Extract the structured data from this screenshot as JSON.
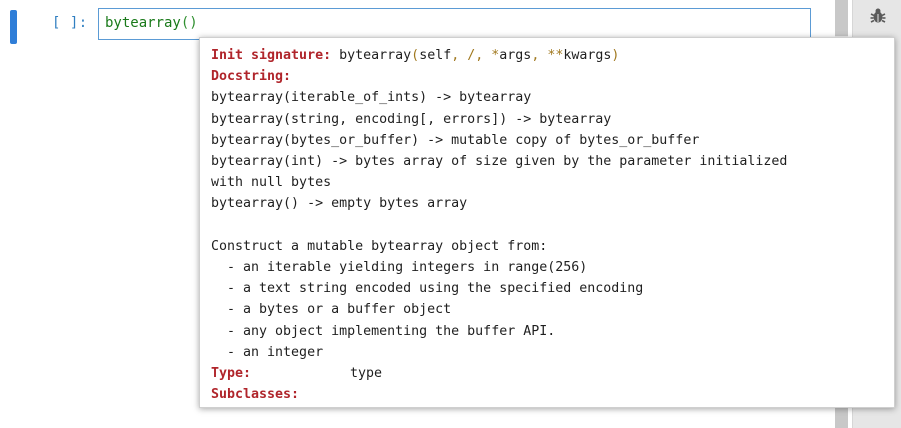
{
  "cell": {
    "prompt": "[ ]:",
    "code_name": "bytearray",
    "code_parens": "()"
  },
  "tooltip": {
    "init_signature_label": "Init signature:",
    "signature_parts": [
      "bytearray",
      "(",
      "self",
      ", ",
      "/",
      ", ",
      "*",
      "args",
      ", ",
      "**",
      "kwargs",
      ")"
    ],
    "docstring_label": "Docstring:",
    "docstring_lines": [
      "bytearray(iterable_of_ints) -> bytearray",
      "bytearray(string, encoding[, errors]) -> bytearray",
      "bytearray(bytes_or_buffer) -> mutable copy of bytes_or_buffer",
      "bytearray(int) -> bytes array of size given by the parameter initialized",
      "with null bytes",
      "bytearray() -> empty bytes array",
      "",
      "Construct a mutable bytearray object from:",
      "  - an iterable yielding integers in range(256)",
      "  - a text string encoded using the specified encoding",
      "  - a bytes or a buffer object",
      "  - any object implementing the buffer API.",
      "  - an integer"
    ],
    "type_label": "Type:",
    "type_value": "type",
    "subclasses_label": "Subclasses:"
  },
  "icons": {
    "debugger": "bug-icon"
  },
  "colors": {
    "accent": "#2f7ed8",
    "label_red": "#b0252b",
    "code_green": "#1a7a1a",
    "prompt_blue": "#307fc1"
  }
}
